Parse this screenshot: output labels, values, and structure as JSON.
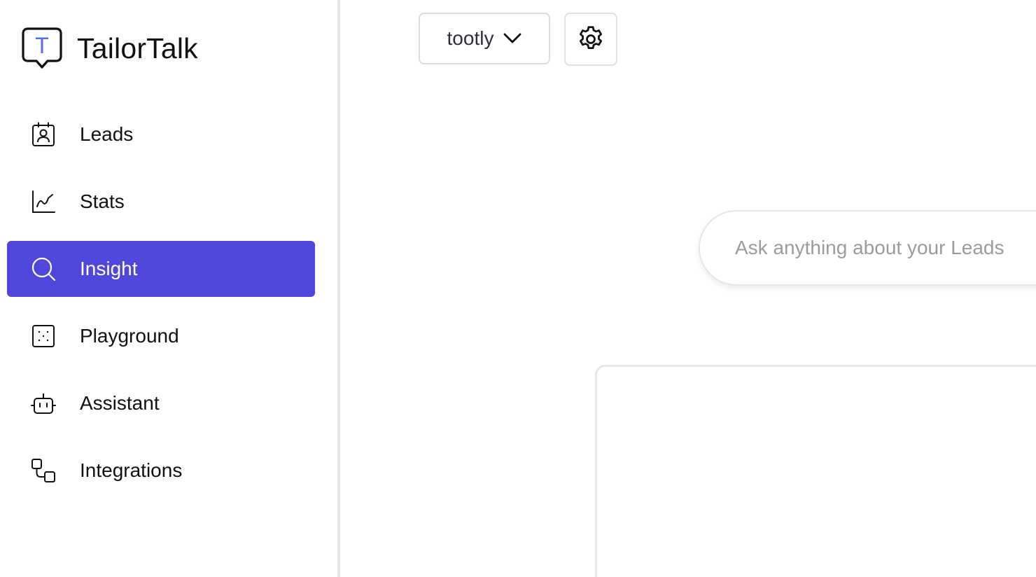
{
  "app": {
    "name": "TailorTalk",
    "accent_color": "#4f46dc",
    "logo_letter": "T"
  },
  "sidebar": {
    "items": [
      {
        "label": "Leads",
        "icon": "contact-card-icon",
        "active": false
      },
      {
        "label": "Stats",
        "icon": "line-chart-icon",
        "active": false
      },
      {
        "label": "Insight",
        "icon": "search-icon",
        "active": true
      },
      {
        "label": "Playground",
        "icon": "dice-icon",
        "active": false
      },
      {
        "label": "Assistant",
        "icon": "robot-icon",
        "active": false
      },
      {
        "label": "Integrations",
        "icon": "flow-nodes-icon",
        "active": false
      }
    ]
  },
  "header": {
    "workspace_selected": "tootly",
    "settings_icon": "gear-icon"
  },
  "main": {
    "ask_placeholder": "Ask anything about your Leads",
    "ask_value": ""
  }
}
